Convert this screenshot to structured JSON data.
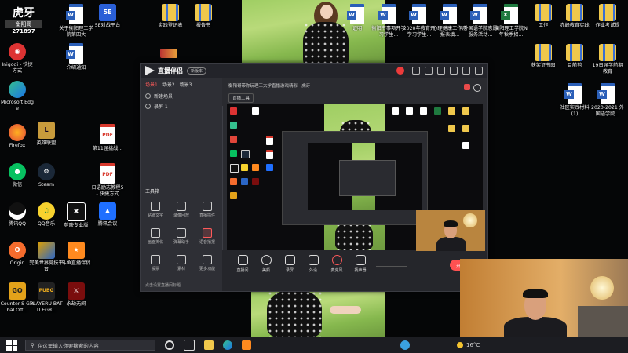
{
  "desktop": {
    "watermark": {
      "brand": "虎牙",
      "name": "衡阳哥",
      "id": "271897"
    },
    "icons_left": [
      {
        "label": "Inigodi - 快捷方式",
        "type": "app"
      },
      {
        "label": "Microsoft Edge",
        "type": "edge"
      },
      {
        "label": "Firefox",
        "type": "firefox"
      },
      {
        "label": "微信",
        "type": "wechat"
      },
      {
        "label": "腾讯QQ",
        "type": "qq"
      },
      {
        "label": "Origin",
        "type": "origin"
      },
      {
        "label": "Counter-S Global Off...",
        "type": "csgo"
      }
    ],
    "icons_col2": [
      {
        "label": "英雄联盟",
        "type": "lol"
      },
      {
        "label": "Steam",
        "type": "steam"
      },
      {
        "label": "QQ音乐",
        "type": "qqmusic"
      },
      {
        "label": "完美世界竞技平台",
        "type": "perfect"
      },
      {
        "label": "PLAYERU BATTLEGR...",
        "type": "pubg"
      }
    ],
    "icons_col3": [
      {
        "label": "关于衡阳理工学院第四大",
        "type": "doc"
      },
      {
        "label": "介绍通知",
        "type": "doc"
      },
      {
        "label": "剪映专业版",
        "type": "capcut"
      },
      {
        "label": "斗鱼直播伴侣",
        "type": "douyu"
      },
      {
        "label": "永劫无间",
        "type": "naraka"
      }
    ],
    "icons_col4": [
      {
        "label": "5E对战平台",
        "type": "5e"
      },
      {
        "label": "第11届挑战...",
        "type": "pdf"
      },
      {
        "label": "日语励志教程5 - 快捷方式",
        "type": "pdf"
      },
      {
        "label": "腾讯会议",
        "type": "meeting"
      }
    ],
    "icons_top_mid": [
      {
        "label": "实践登记表",
        "type": "zip"
      },
      {
        "label": "报告书",
        "type": "zip"
      }
    ],
    "icons_top_right": [
      {
        "label": "证明",
        "type": "doc"
      },
      {
        "label": "衡阳市事项开学习学生...",
        "type": "doc"
      },
      {
        "label": "2020年教育开学习学生...",
        "type": "doc"
      },
      {
        "label": "心理健康工作月报表填...",
        "type": "doc"
      },
      {
        "label": "外国语学院志愿服务活动...",
        "type": "doc"
      },
      {
        "label": "衡阳理工学院N年秋季招...",
        "type": "xls"
      },
      {
        "label": "工作",
        "type": "zip"
      },
      {
        "label": "赤峰教育实践",
        "type": "zip"
      },
      {
        "label": "作业考试提",
        "type": "zip"
      }
    ],
    "icons_right": [
      {
        "label": "获奖证书图",
        "type": "zip"
      },
      {
        "label": "目前剪",
        "type": "zip"
      },
      {
        "label": "19日届学前期教育",
        "type": "zip"
      },
      {
        "label": "社区实践材料(1)",
        "type": "doc"
      },
      {
        "label": "2020-2021 外国语学院...",
        "type": "doc"
      }
    ]
  },
  "recorder": {
    "app_name": "直播伴侣",
    "version": "新版本",
    "tabs": [
      "场景1",
      "场景2",
      "场景3"
    ],
    "scene_rows": [
      "新建场景",
      "录屏 1"
    ],
    "tools_title": "工具箱",
    "tools": [
      "贴纸文字",
      "录像回放",
      "直播插件",
      "画面美化",
      "弹幕助手",
      "语音播报",
      "投票",
      "素材",
      "更多功能"
    ],
    "topbar_title": "衡阳哥带你玩理工大学直播游戏精彩 · 虎牙",
    "topbar_btn": "直播工具",
    "bottom_buttons": [
      "直播间",
      "美颜",
      "录屏",
      "外设",
      "麦克风",
      "扬声器"
    ],
    "start_label": "开始直播",
    "footer_note": "点击设置直播间标题"
  },
  "taskbar": {
    "search_placeholder": "在这里输入你要搜索的内容",
    "time": "16°C"
  },
  "colors": {
    "accent": "#ff5151",
    "taskbar": "#1c1d22"
  }
}
